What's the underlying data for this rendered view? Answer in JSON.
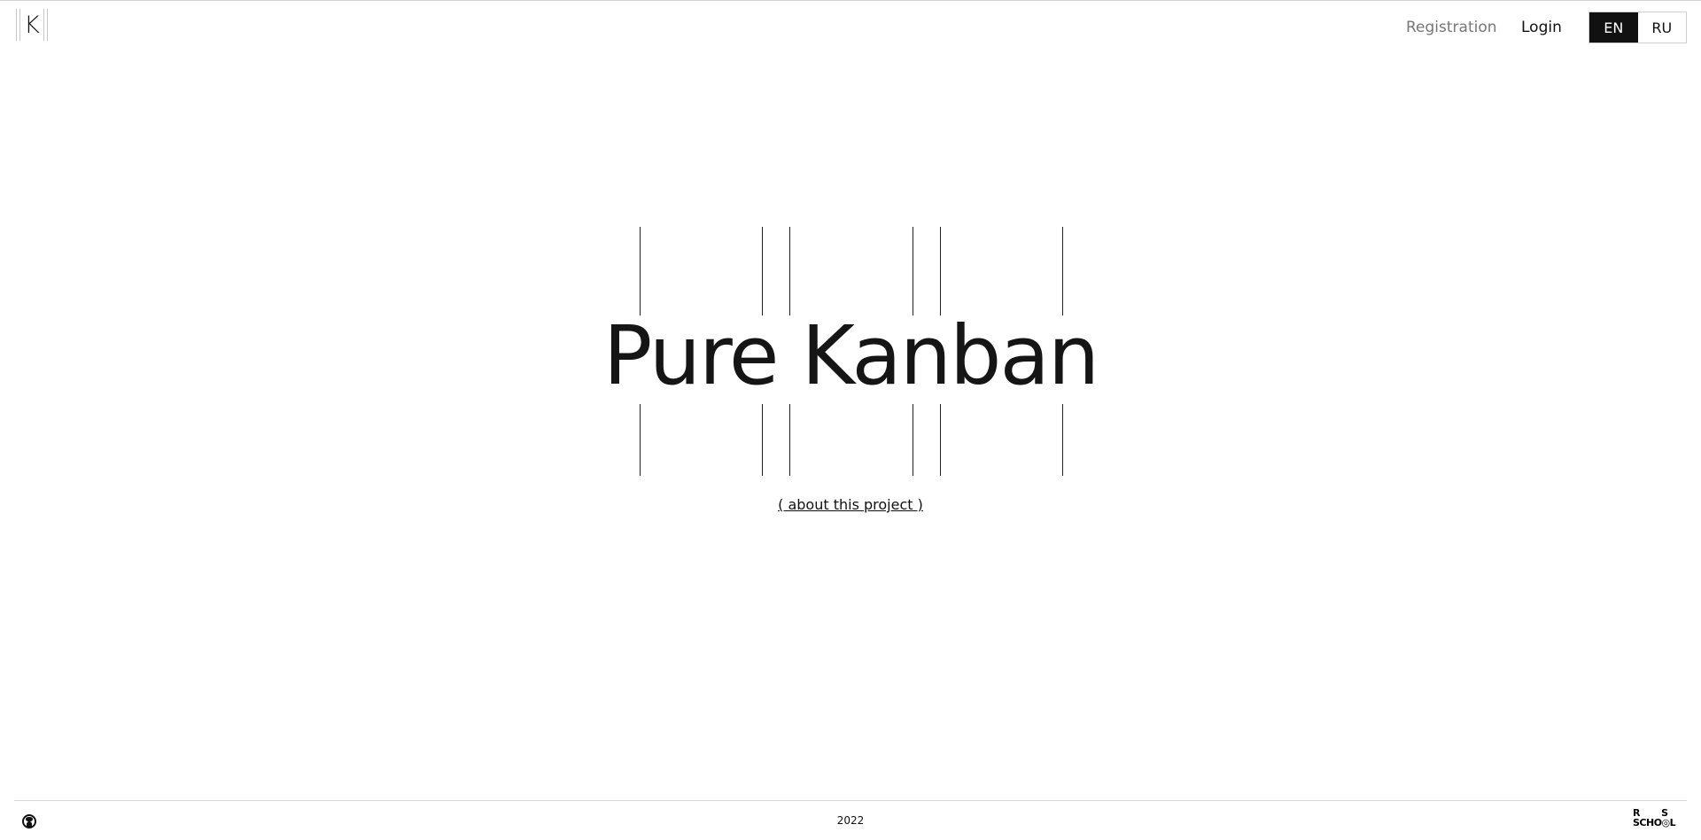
{
  "header": {
    "logo_letter": "K",
    "nav": {
      "registration": "Registration",
      "login": "Login"
    },
    "languages": [
      {
        "label": "EN",
        "active": true
      },
      {
        "label": "RU",
        "active": false
      }
    ]
  },
  "hero": {
    "title": "Pure Kanban",
    "about_link": "( about this project )"
  },
  "footer": {
    "github_icon": "github-icon",
    "year": "2022",
    "school_logo_text": "RS SCHOOL"
  },
  "colors": {
    "text": "#111111",
    "muted_link": "#777777",
    "active_lang_bg": "#111111",
    "active_lang_text": "#ffffff",
    "background": "#ffffff"
  }
}
